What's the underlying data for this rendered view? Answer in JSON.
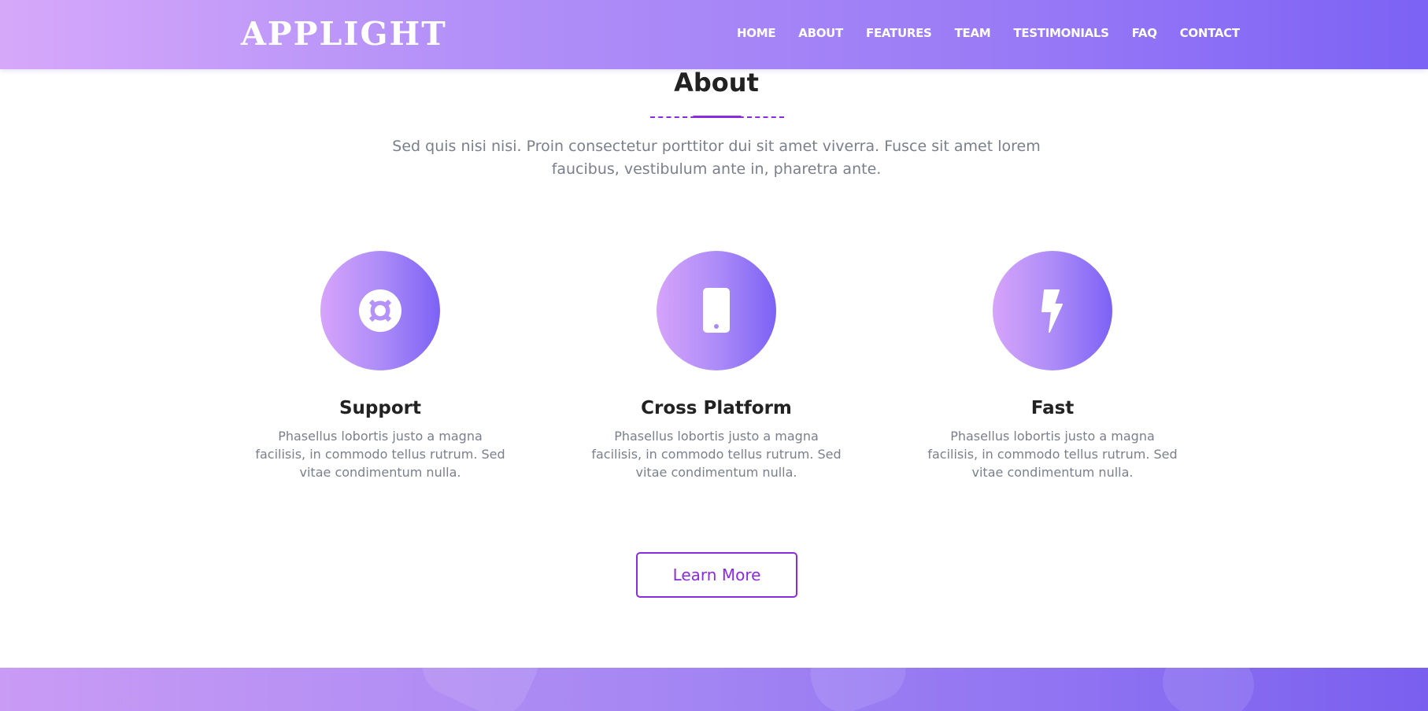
{
  "brand": {
    "logo": "APPLIGHT"
  },
  "nav": {
    "items": [
      {
        "label": "HOME"
      },
      {
        "label": "ABOUT"
      },
      {
        "label": "FEATURES"
      },
      {
        "label": "TEAM"
      },
      {
        "label": "TESTIMONIALS"
      },
      {
        "label": "FAQ"
      },
      {
        "label": "CONTACT"
      }
    ]
  },
  "about": {
    "title": "About",
    "intro": "Sed quis nisi nisi. Proin consectetur porttitor dui sit amet viverra. Fusce sit amet lorem faucibus, vestibulum ante in, pharetra ante.",
    "features": [
      {
        "icon": "lifebuoy-icon",
        "title": "Support",
        "text": "Phasellus lobortis justo a magna facilisis, in commodo tellus rutrum. Sed vitae condimentum nulla."
      },
      {
        "icon": "mobile-icon",
        "title": "Cross Platform",
        "text": "Phasellus lobortis justo a magna facilisis, in commodo tellus rutrum. Sed vitae condimentum nulla."
      },
      {
        "icon": "lightning-icon",
        "title": "Fast",
        "text": "Phasellus lobortis justo a magna facilisis, in commodo tellus rutrum. Sed vitae condimentum nulla."
      }
    ],
    "button_label": "Learn More"
  },
  "colors": {
    "accent": "#8a2be2",
    "gradient_start": "#d6a8fa",
    "gradient_end": "#7c62f5",
    "heading": "#222222",
    "body_text": "#7a7f8c"
  }
}
